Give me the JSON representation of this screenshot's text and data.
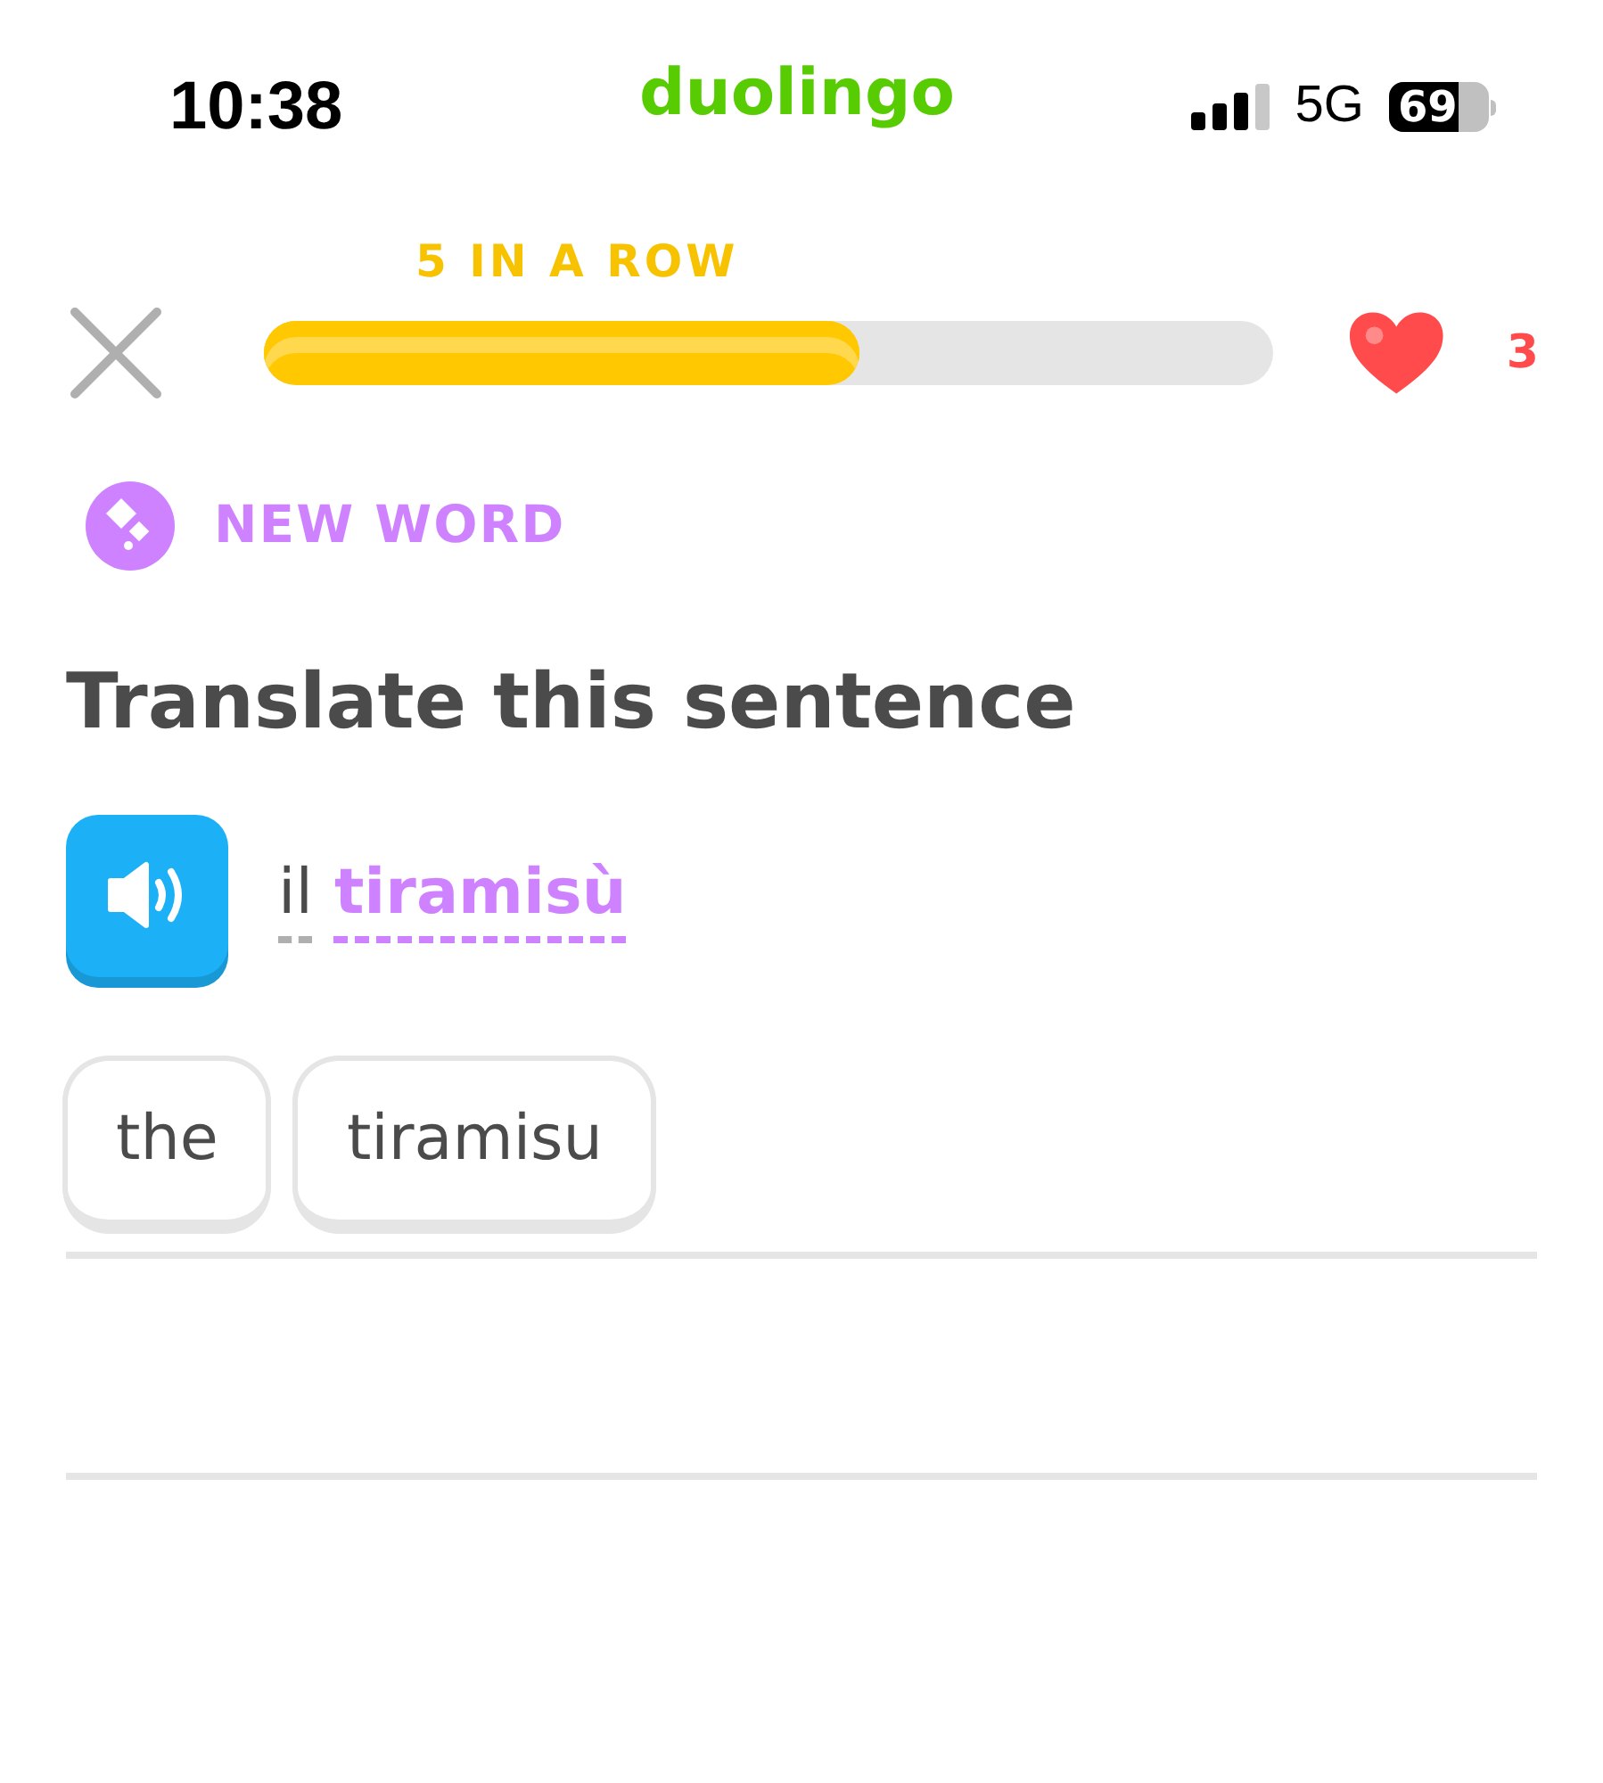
{
  "status_bar": {
    "time": "10:38",
    "app": "duolingo",
    "network": "5G",
    "battery": "69"
  },
  "lesson_header": {
    "streak_label": "5 IN A ROW",
    "progress": {
      "level": 0.59
    },
    "hearts": "3"
  },
  "badge": {
    "label": "NEW WORD"
  },
  "title": "Translate this sentence",
  "prompt": {
    "words": [
      {
        "text": "il",
        "new": false
      },
      {
        "text": "tiramisù",
        "new": true
      }
    ]
  },
  "answer_tiles": [
    {
      "text": "the"
    },
    {
      "text": "tiramisu"
    }
  ]
}
